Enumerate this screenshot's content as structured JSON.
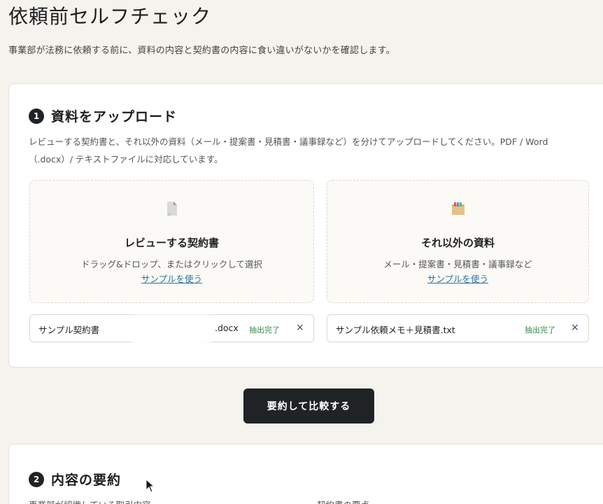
{
  "page": {
    "title": "依頼前セルフチェック",
    "description": "事業部が法務に依頼する前に、資料の内容と契約書の内容に食い違いがないかを確認します。"
  },
  "step1": {
    "number": "1",
    "title": "資料をアップロード",
    "description": "レビューする契約書と、それ以外の資料（メール・提案書・見積書・議事録など）を分けてアップロードしてください。PDF / Word（.docx）/ テキストファイルに対応しています。",
    "contract_zone": {
      "icon": "document-icon",
      "title": "レビューする契約書",
      "subtitle": "ドラッグ&ドロップ、またはクリックして選択",
      "sample_link": "サンプルを使う"
    },
    "other_zone": {
      "icon": "folder-icon",
      "title": "それ以外の資料",
      "subtitle": "メール・提案書・見積書・議事録など",
      "sample_link": "サンプルを使う"
    },
    "contract_file": {
      "name": "サンプル契約書",
      "extension": ".docx",
      "status": "抽出完了",
      "remove": "×"
    },
    "other_file": {
      "name": "サンプル依頼メモ＋見積書.txt",
      "status": "抽出完了",
      "remove": "×"
    }
  },
  "actions": {
    "compare_button": "要約して比較する"
  },
  "step2": {
    "number": "2",
    "title": "内容の要約",
    "left_column_label": "事業部が認識している取引内容",
    "right_column_label": "契約書の要点"
  },
  "colors": {
    "background": "#f5f3ee",
    "primary": "#1f2326",
    "link": "#2f6f9f",
    "success": "#3b8a4a"
  }
}
